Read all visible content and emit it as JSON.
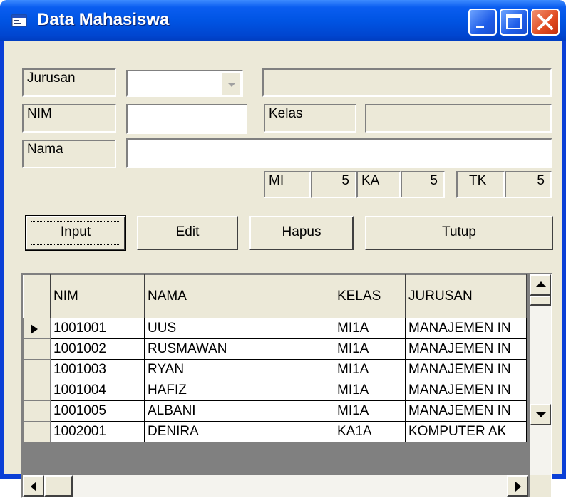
{
  "window": {
    "title": "Data Mahasiswa",
    "icon": "app-form-icon"
  },
  "form": {
    "jurusan_label": "Jurusan",
    "jurusan_value": "",
    "jurusan_display": "",
    "nim_label": "NIM",
    "nim_value": "",
    "kelas_label": "Kelas",
    "kelas_value": "",
    "nama_label": "Nama",
    "nama_value": "",
    "counters": [
      {
        "label": "MI",
        "value": "5"
      },
      {
        "label": "KA",
        "value": "5"
      },
      {
        "label": "TK",
        "value": "5"
      }
    ]
  },
  "buttons": {
    "input": "Input",
    "edit": "Edit",
    "hapus": "Hapus",
    "tutup": "Tutup"
  },
  "grid": {
    "columns": [
      "NIM",
      "NAMA",
      "KELAS",
      "JURUSAN"
    ],
    "rows": [
      [
        "1001001",
        "UUS",
        "MI1A",
        "MANAJEMEN IN"
      ],
      [
        "1001002",
        "RUSMAWAN",
        "MI1A",
        "MANAJEMEN IN"
      ],
      [
        "1001003",
        "RYAN",
        "MI1A",
        "MANAJEMEN IN"
      ],
      [
        "1001004",
        "HAFIZ",
        "MI1A",
        "MANAJEMEN IN"
      ],
      [
        "1001005",
        "ALBANI",
        "MI1A",
        "MANAJEMEN IN"
      ],
      [
        "1002001",
        "DENIRA",
        "KA1A",
        "KOMPUTER AK"
      ]
    ]
  }
}
